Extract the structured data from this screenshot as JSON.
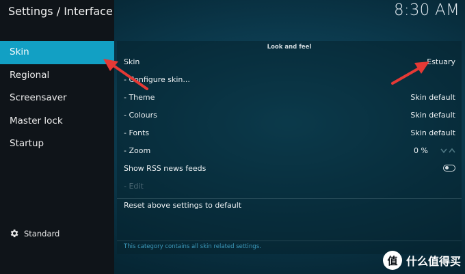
{
  "window": {
    "title": "Settings / Interface",
    "clock": "8:30 AM"
  },
  "sidebar": {
    "items": [
      {
        "label": "Skin",
        "active": true
      },
      {
        "label": "Regional"
      },
      {
        "label": "Screensaver"
      },
      {
        "label": "Master lock"
      },
      {
        "label": "Startup"
      }
    ],
    "level_label": "Standard",
    "level_icon": "gear-icon"
  },
  "content": {
    "section_title": "Look and feel",
    "settings": [
      {
        "label": "Skin",
        "value": "Estuary"
      },
      {
        "label": "- Configure skin..."
      },
      {
        "label": "- Theme",
        "value": "Skin default"
      },
      {
        "label": "- Colours",
        "value": "Skin default"
      },
      {
        "label": "- Fonts",
        "value": "Skin default"
      },
      {
        "label": "- Zoom",
        "value": "0 %"
      },
      {
        "label": "Show RSS news feeds",
        "toggle_on": false
      },
      {
        "label": "- Edit",
        "disabled": true
      }
    ],
    "reset_label": "Reset above settings to default",
    "description": "This category contains all skin related settings."
  },
  "watermark": {
    "text": "什么值得买",
    "logo_glyph": "值"
  },
  "colors": {
    "accent": "#12a0c4",
    "sidebar_bg": "#0f1419",
    "annotation_arrow": "#e53935",
    "description_text": "#3d9bbd"
  }
}
